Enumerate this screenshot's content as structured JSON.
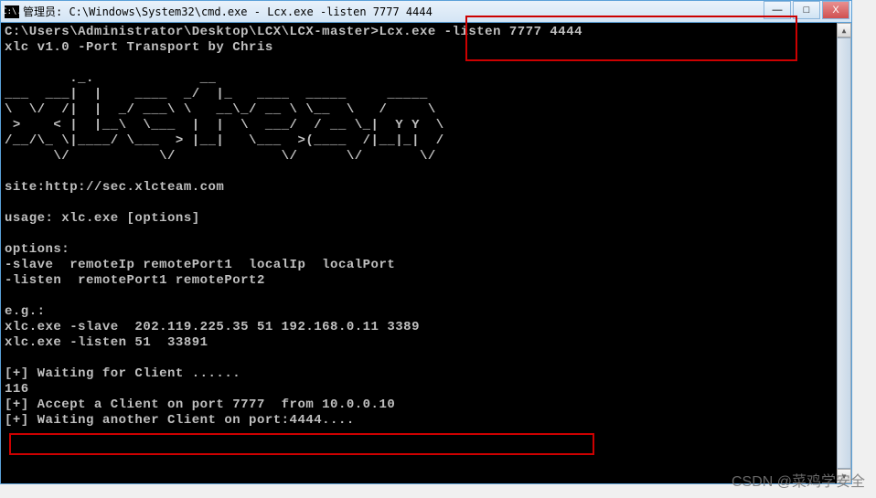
{
  "window": {
    "icon_text": "C:\\.",
    "title": "管理员: C:\\Windows\\System32\\cmd.exe - Lcx.exe  -listen 7777 4444",
    "controls": {
      "minimize": "—",
      "maximize": "□",
      "close": "X"
    }
  },
  "terminal": {
    "prompt_path": "C:\\Users\\Administrator\\Desktop\\LCX\\LCX-master>",
    "command": "Lcx.exe -listen 7777 4444",
    "version_line": "xlc v1.0 -Port Transport by Chris",
    "ascii_art_1": "        ._.             __                           ",
    "ascii_art_2": "___  ___|  |    ____  _/  |_   ____  _____     _____  ",
    "ascii_art_3": "\\  \\/  /|  |  _/ ___\\ \\   __\\_/ __ \\ \\__  \\   /     \\ ",
    "ascii_art_4": " >    < |  |__\\  \\___  |  |  \\  ___/  / __ \\_|  Y Y  \\",
    "ascii_art_5": "/__/\\_ \\|____/ \\___  > |__|   \\___  >(____  /|__|_|  /",
    "ascii_art_6": "      \\/           \\/             \\/      \\/       \\/ ",
    "site_line": "site:http://sec.xlcteam.com",
    "usage_line": "usage: xlc.exe [options]",
    "options_header": "options:",
    "option_slave": "-slave  remoteIp remotePort1  localIp  localPort",
    "option_listen": "-listen  remotePort1 remotePort2",
    "eg_header": "e.g.:",
    "eg_slave": "xlc.exe -slave  202.119.225.35 51 192.168.0.11 3389",
    "eg_listen": "xlc.exe -listen 51  33891",
    "waiting_line": "[+] Waiting for Client ......",
    "num_line": "116",
    "accept_line": "[+] Accept a Client on port 7777  from 10.0.0.10",
    "waiting2_line": "[+] Waiting another Client on port:4444...."
  },
  "watermark": "CSDN @菜鸡学安全"
}
